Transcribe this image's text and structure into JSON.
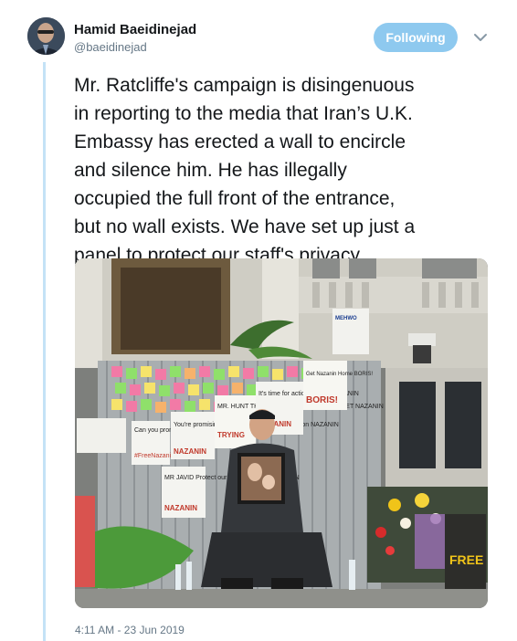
{
  "author": {
    "display_name": "Hamid Baeidinejad",
    "handle": "@baeidinejad"
  },
  "follow_button_label": "Following",
  "tweet": {
    "lines": [
      "Mr. Ratcliffe's campaign is disingenuous",
      "in reporting to the media that Iran’s U.K.",
      "Embassy has erected a wall to encircle",
      "and silence him. He has illegally",
      "occupied the full front of the entrance,",
      "but no wall exists. We have set up just a",
      "panel to protect our staff's privacy."
    ],
    "timestamp": "4:11 AM - 23 Jun 2019"
  },
  "photo_signs": {
    "sign1": "Can you promise all our citizens a bright future?",
    "sign2": "#FreeNazanin",
    "sign3": "You're promising us a bright future with 3 million NAZANIN",
    "sign4": "MR. HUNT THANK YOU FOR TRYING TO GET NAZANIN",
    "sign5": "It's time for action. FREE NAZANIN",
    "sign6": "Get Nazanin Home BORIS!",
    "sign7": "MR JAVID Protect our British citizens NAZANIN",
    "sign8": "FREE NAZANIN",
    "sign9": "MEHWO"
  },
  "colors": {
    "accent": "#8ec9ef",
    "thread_line": "#c4e2f6",
    "text": "#14171a",
    "muted": "#657786"
  }
}
